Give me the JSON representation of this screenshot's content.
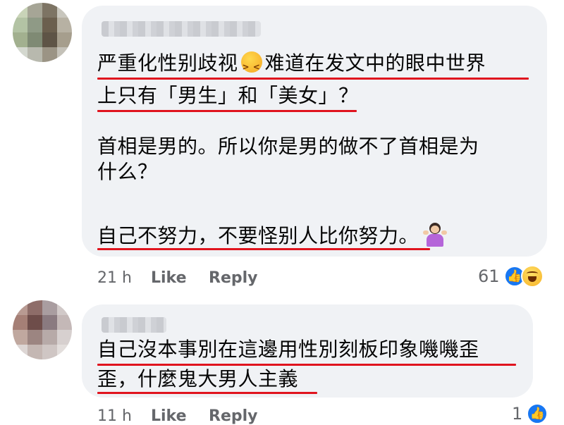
{
  "comments": [
    {
      "lines": [
        "严重化性别歧视",
        "难道在发文中的眼中世界",
        "上只有「男生」和「美女」？",
        "首相是男的。所以你是男的做不了首相是为",
        "什么？",
        "自己不努力，不要怪别人比你努力。"
      ],
      "emoji_1": "persevering-face-emoji",
      "emoji_2": "person-shrugging-emoji",
      "time": "21 h",
      "like": "Like",
      "reply": "Reply",
      "reaction_count": "61"
    },
    {
      "lines": [
        "自己沒本事別在這邊用性別刻板印象嘰嘰歪",
        "歪，什麼鬼大男人主義"
      ],
      "time": "11 h",
      "like": "Like",
      "reply": "Reply",
      "reaction_count": "1"
    }
  ],
  "colors": {
    "bubble": "#f0f2f5",
    "underline": "#e0141e",
    "meta": "#65676b",
    "like_blue": "#1877f2"
  },
  "icons": [
    "like-icon",
    "haha-icon"
  ]
}
